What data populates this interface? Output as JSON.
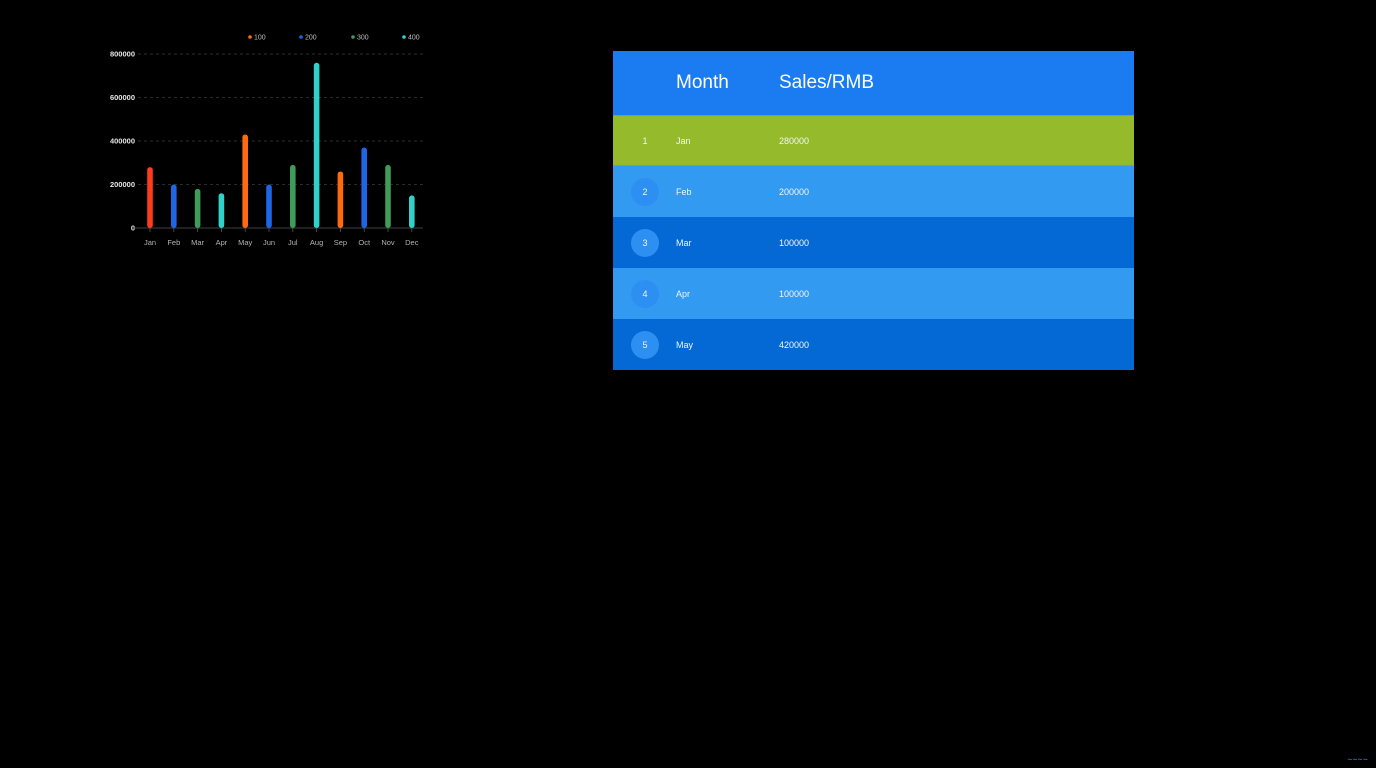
{
  "chart_data": {
    "type": "bar",
    "categories": [
      "Jan",
      "Feb",
      "Mar",
      "Apr",
      "May",
      "Jun",
      "Jul",
      "Aug",
      "Sep",
      "Oct",
      "Nov",
      "Dec"
    ],
    "values": [
      280000,
      200000,
      180000,
      160000,
      430000,
      200000,
      290000,
      760000,
      260000,
      370000,
      290000,
      150000
    ],
    "bar_colors": [
      "#ff3b1f",
      "#1f66e5",
      "#3f9b5a",
      "#2fd1c9",
      "#ff6a10",
      "#1f66e5",
      "#3f9b5a",
      "#2fd1c9",
      "#ff6a10",
      "#1f66e5",
      "#3f9b5a",
      "#2fd1c9"
    ],
    "ylim": [
      0,
      800000
    ],
    "yticks": [
      "800000",
      "600000",
      "400000",
      "200000",
      "0"
    ],
    "grid": true,
    "legend_position": "top-right",
    "legend": [
      {
        "label": "100",
        "color": "#ff6a10"
      },
      {
        "label": "200",
        "color": "#1f66e5"
      },
      {
        "label": "300",
        "color": "#3f9b5a"
      },
      {
        "label": "400",
        "color": "#2fd1c9"
      }
    ]
  },
  "table": {
    "headers": {
      "month": "Month",
      "sales": "Sales/RMB"
    },
    "rows": [
      {
        "rank": "1",
        "month": "Jan",
        "sales": "280000"
      },
      {
        "rank": "2",
        "month": "Feb",
        "sales": "200000"
      },
      {
        "rank": "3",
        "month": "Mar",
        "sales": "100000"
      },
      {
        "rank": "4",
        "month": "Apr",
        "sales": "100000"
      },
      {
        "rank": "5",
        "month": "May",
        "sales": "420000"
      }
    ],
    "colors": {
      "header": "#1a7cf0",
      "highlight": "#95ba2c",
      "light": "#339af2",
      "dark": "#0569d5"
    }
  },
  "watermark": "~~~~"
}
